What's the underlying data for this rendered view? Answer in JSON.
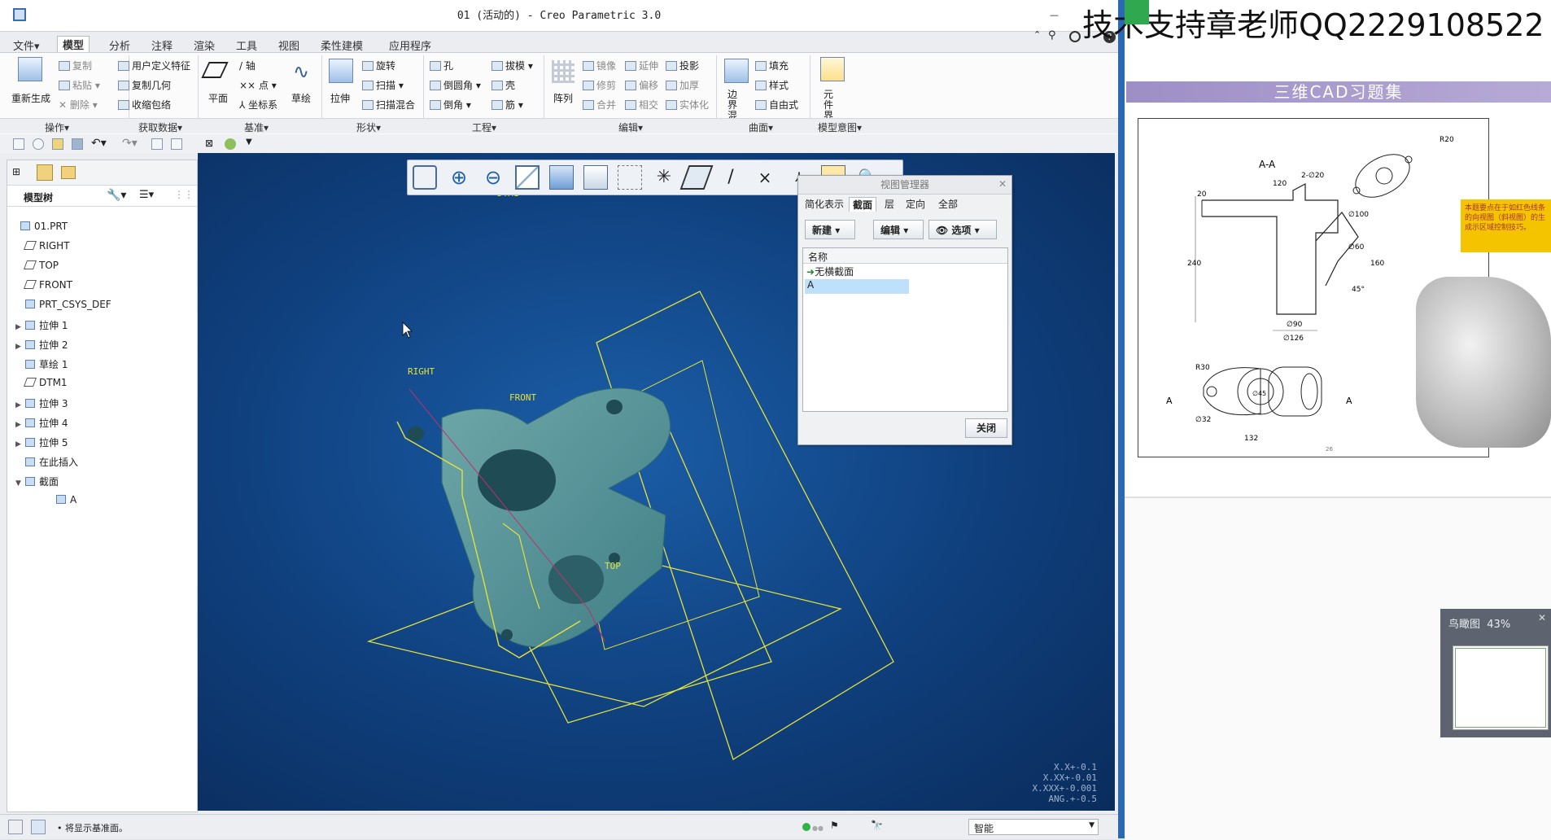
{
  "window": {
    "title": "01 (活动的) - Creo Parametric 3.0",
    "watermark": "技术支持章老师QQ2229108522"
  },
  "menu_tabs": [
    "文件▾",
    "模型",
    "分析",
    "注释",
    "渲染",
    "工具",
    "视图",
    "柔性建模",
    "应用程序"
  ],
  "ribbon": {
    "regenerate": "重新生成",
    "copy": "复制",
    "paste": "粘贴",
    "delete": "删除",
    "udf": "用户定义特征",
    "copy_geom": "复制几何",
    "shrinkwrap": "收缩包络",
    "plane": "平面",
    "axis": "轴",
    "point": "点",
    "csys": "坐标系",
    "sketch": "草绘",
    "extrude": "拉伸",
    "revolve": "旋转",
    "sweep": "扫描",
    "swept_blend": "扫描混合",
    "hole": "孔",
    "round": "倒圆角",
    "chamfer": "倒角",
    "draft": "拔模",
    "shell": "壳",
    "rib": "筋",
    "pattern": "阵列",
    "mirror": "镜像",
    "trim": "修剪",
    "merge": "合并",
    "extend": "延伸",
    "offset": "偏移",
    "intersect": "相交",
    "project": "投影",
    "thicken": "加厚",
    "solidify": "实体化",
    "boundary_blend": "边界混合",
    "fill": "填充",
    "style": "样式",
    "freestyle": "自由式",
    "component_interface": "元件界面",
    "groups": [
      "操作▾",
      "获取数据▾",
      "基准▾",
      "形状▾",
      "工程▾",
      "编辑▾",
      "曲面▾",
      "模型意图▾"
    ]
  },
  "model_tree": {
    "header": "模型树",
    "items": [
      {
        "label": "01.PRT",
        "arrow": ""
      },
      {
        "label": "RIGHT",
        "arrow": ""
      },
      {
        "label": "TOP",
        "arrow": ""
      },
      {
        "label": "FRONT",
        "arrow": ""
      },
      {
        "label": "PRT_CSYS_DEF",
        "arrow": ""
      },
      {
        "label": "拉伸 1",
        "arrow": "▶"
      },
      {
        "label": "拉伸 2",
        "arrow": "▶"
      },
      {
        "label": "草绘 1",
        "arrow": ""
      },
      {
        "label": "DTM1",
        "arrow": ""
      },
      {
        "label": "拉伸 3",
        "arrow": "▶"
      },
      {
        "label": "拉伸 4",
        "arrow": "▶"
      },
      {
        "label": "拉伸 5",
        "arrow": "▶"
      },
      {
        "label": "在此插入",
        "arrow": ""
      },
      {
        "label": "截面",
        "arrow": "▼"
      },
      {
        "label": "A",
        "arrow": ""
      }
    ]
  },
  "viewport": {
    "datum_labels": [
      "DTM1",
      "RIGHT",
      "FRONT",
      "TOP"
    ],
    "coords": [
      "X.X+-0.1",
      "X.XX+-0.01",
      "X.XXX+-0.001",
      "ANG.+-0.5"
    ]
  },
  "view_manager": {
    "title": "视图管理器",
    "tabs": [
      "简化表示",
      "截面",
      "层",
      "定向",
      "全部"
    ],
    "new_btn": "新建",
    "edit_btn": "编辑",
    "options_btn": "选项",
    "column": "名称",
    "rows": [
      "无横截面",
      "A"
    ],
    "close": "关闭"
  },
  "status": {
    "message": "• 将显示基准面。",
    "filter": "智能"
  },
  "doc": {
    "book_title": "三维CAD习题集",
    "section": "A-A",
    "dims": [
      "20",
      "120",
      "2-∅20",
      "R20",
      "∅100",
      "∅60",
      "240",
      "160",
      "45°",
      "∅90",
      "∅126",
      "R30",
      "∅32",
      "∅45",
      "132",
      "A",
      "A"
    ],
    "note": "本题要点在于如红色线条的向视图（斜视图）的生成示区域控制技巧。",
    "page": "26"
  },
  "navigator": {
    "label": "鸟瞰图",
    "zoom": "43%"
  }
}
